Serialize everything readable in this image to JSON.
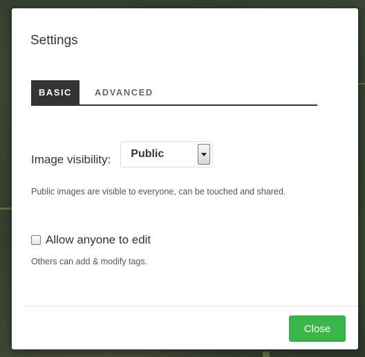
{
  "dialog": {
    "title": "Settings"
  },
  "tabs": [
    {
      "label": "BASIC",
      "active": true
    },
    {
      "label": "ADVANCED",
      "active": false
    }
  ],
  "visibility": {
    "label": "Image visibility:",
    "selected": "Public",
    "help": "Public images are visible to everyone, can be touched and shared."
  },
  "edit": {
    "label": "Allow anyone to edit",
    "checked": false,
    "help": "Others can add & modify tags."
  },
  "footer": {
    "close_label": "Close"
  },
  "colors": {
    "active_tab": "#333333",
    "close_button": "#3bb44a"
  }
}
